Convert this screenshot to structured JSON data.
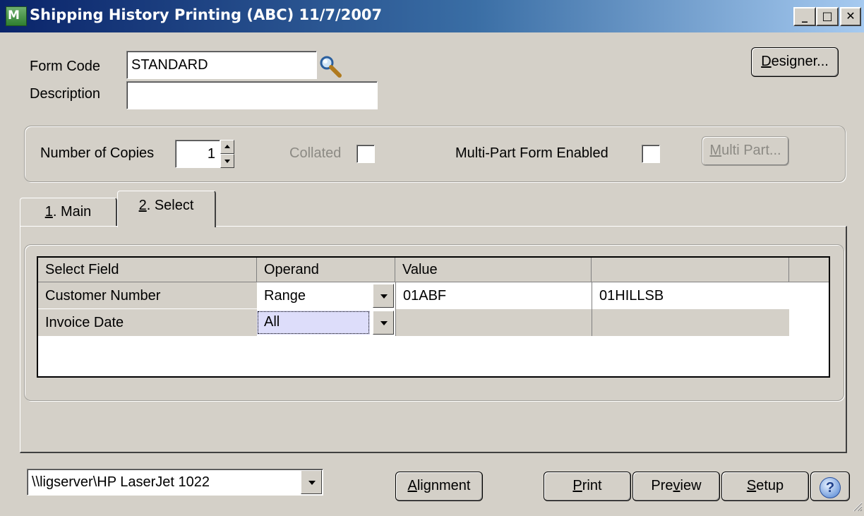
{
  "window": {
    "title": "Shipping History Printing (ABC) 11/7/2007",
    "minimize_glyph": "_",
    "maximize_glyph": "□",
    "close_glyph": "✕"
  },
  "form": {
    "form_code_label": "Form Code",
    "form_code_value": "STANDARD",
    "description_label": "Description",
    "description_value": "",
    "designer_button": "Designer...",
    "designer_mnemonic": "D",
    "designer_rest": "esigner..."
  },
  "copies": {
    "number_of_copies_label": "Number of Copies",
    "number_of_copies_value": "1",
    "collated_label": "Collated",
    "multipart_enabled_label": "Multi-Part Form Enabled",
    "multipart_button_mnemonic": "M",
    "multipart_button_rest": "ulti Part..."
  },
  "tabs": [
    {
      "mnemonic": "1",
      "rest": ". Main"
    },
    {
      "mnemonic": "2",
      "rest": ". Select"
    }
  ],
  "grid": {
    "headers": [
      "Select Field",
      "Operand",
      "Value",
      ""
    ],
    "rows": [
      {
        "field": "Customer Number",
        "operand": "Range",
        "value1": "01ABF",
        "value2": "01HILLSB"
      },
      {
        "field": "Invoice Date",
        "operand": "All",
        "value1": "",
        "value2": ""
      }
    ]
  },
  "footer": {
    "printer": "\\\\ligserver\\HP LaserJet 1022",
    "alignment_mnemonic": "A",
    "alignment_rest": "lignment",
    "print_mnemonic": "P",
    "print_rest": "rint",
    "preview_pre": "Pre",
    "preview_mnemonic": "v",
    "preview_rest": "iew",
    "setup_mnemonic": "S",
    "setup_rest": "etup",
    "help_glyph": "?"
  },
  "colors": {
    "titlebar_start": "#0a246a",
    "titlebar_end": "#a6caf0",
    "dialog_bg": "#d4d0c8",
    "selected_cell_bg": "#ddddfa"
  }
}
